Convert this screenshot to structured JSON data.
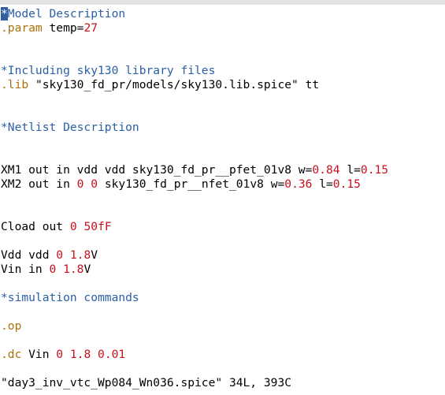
{
  "editor": {
    "lines": {
      "l1": {
        "cursor": "*",
        "text": "Model Description"
      },
      "l2": {
        "kw": ".param",
        "mid": " temp=",
        "num": "27"
      },
      "l5": "*Including sky130 library files",
      "l6": {
        "kw": ".lib",
        "rest": " \"sky130_fd_pr/models/sky130.lib.spice\" tt"
      },
      "l9": "*Netlist Description",
      "l12": {
        "a": "XM1 out in vdd vdd sky130_fd_pr__pfet_01v8 w=",
        "n1": "0.84",
        "b": " l=",
        "n2": "0.15"
      },
      "l13": {
        "a": "XM2 out in ",
        "n0": "0",
        "s": " ",
        "n0b": "0",
        "b": " sky130_fd_pr__nfet_01v8 w=",
        "n1": "0.36",
        "c": " l=",
        "n2": "0.15"
      },
      "l16": {
        "a": "Cload out ",
        "n0": "0",
        "s": " ",
        "n1": "50",
        "unit": "fF"
      },
      "l18": {
        "a": "Vdd vdd ",
        "n0": "0",
        "s": " ",
        "n1": "1.8",
        "unit": "V"
      },
      "l19": {
        "a": "Vin in ",
        "n0": "0",
        "s": " ",
        "n1": "1.8",
        "unit": "V"
      },
      "l21": "*simulation commands",
      "l23": ".op",
      "l25": {
        "kw": ".dc",
        "a": " Vin ",
        "n0": "0",
        "s1": " ",
        "n1": "1.8",
        "s2": " ",
        "n2": "0.01"
      }
    },
    "status": "\"day3_inv_vtc_Wp084_Wn036.spice\" 34L, 393C"
  },
  "colors": {
    "comment": "#2a5fa5",
    "keyword": "#a8720a",
    "number": "#c8101c",
    "cursor_bg": "#2f5fa0"
  }
}
